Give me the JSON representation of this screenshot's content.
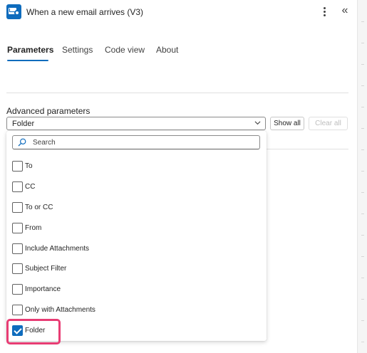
{
  "header": {
    "title": "When a new email arrives (V3)",
    "app_icon": "outlook-icon",
    "more_icon": "more-vertical-icon",
    "collapse_icon": "double-chevron-left-icon",
    "collapse_glyph": "«"
  },
  "tabs": [
    {
      "label": "Parameters",
      "active": true
    },
    {
      "label": "Settings",
      "active": false
    },
    {
      "label": "Code view",
      "active": false
    },
    {
      "label": "About",
      "active": false
    }
  ],
  "advanced": {
    "label": "Advanced parameters",
    "selected_value": "Folder",
    "show_all_label": "Show all",
    "clear_all_label": "Clear all"
  },
  "dropdown": {
    "search_placeholder": "Search",
    "options": [
      {
        "label": "To",
        "checked": false
      },
      {
        "label": "CC",
        "checked": false
      },
      {
        "label": "To or CC",
        "checked": false
      },
      {
        "label": "From",
        "checked": false
      },
      {
        "label": "Include Attachments",
        "checked": false
      },
      {
        "label": "Subject Filter",
        "checked": false
      },
      {
        "label": "Importance",
        "checked": false
      },
      {
        "label": "Only with Attachments",
        "checked": false
      },
      {
        "label": "Folder",
        "checked": true
      }
    ]
  },
  "colors": {
    "accent": "#0f6cbd",
    "highlight": "#e83c74"
  }
}
